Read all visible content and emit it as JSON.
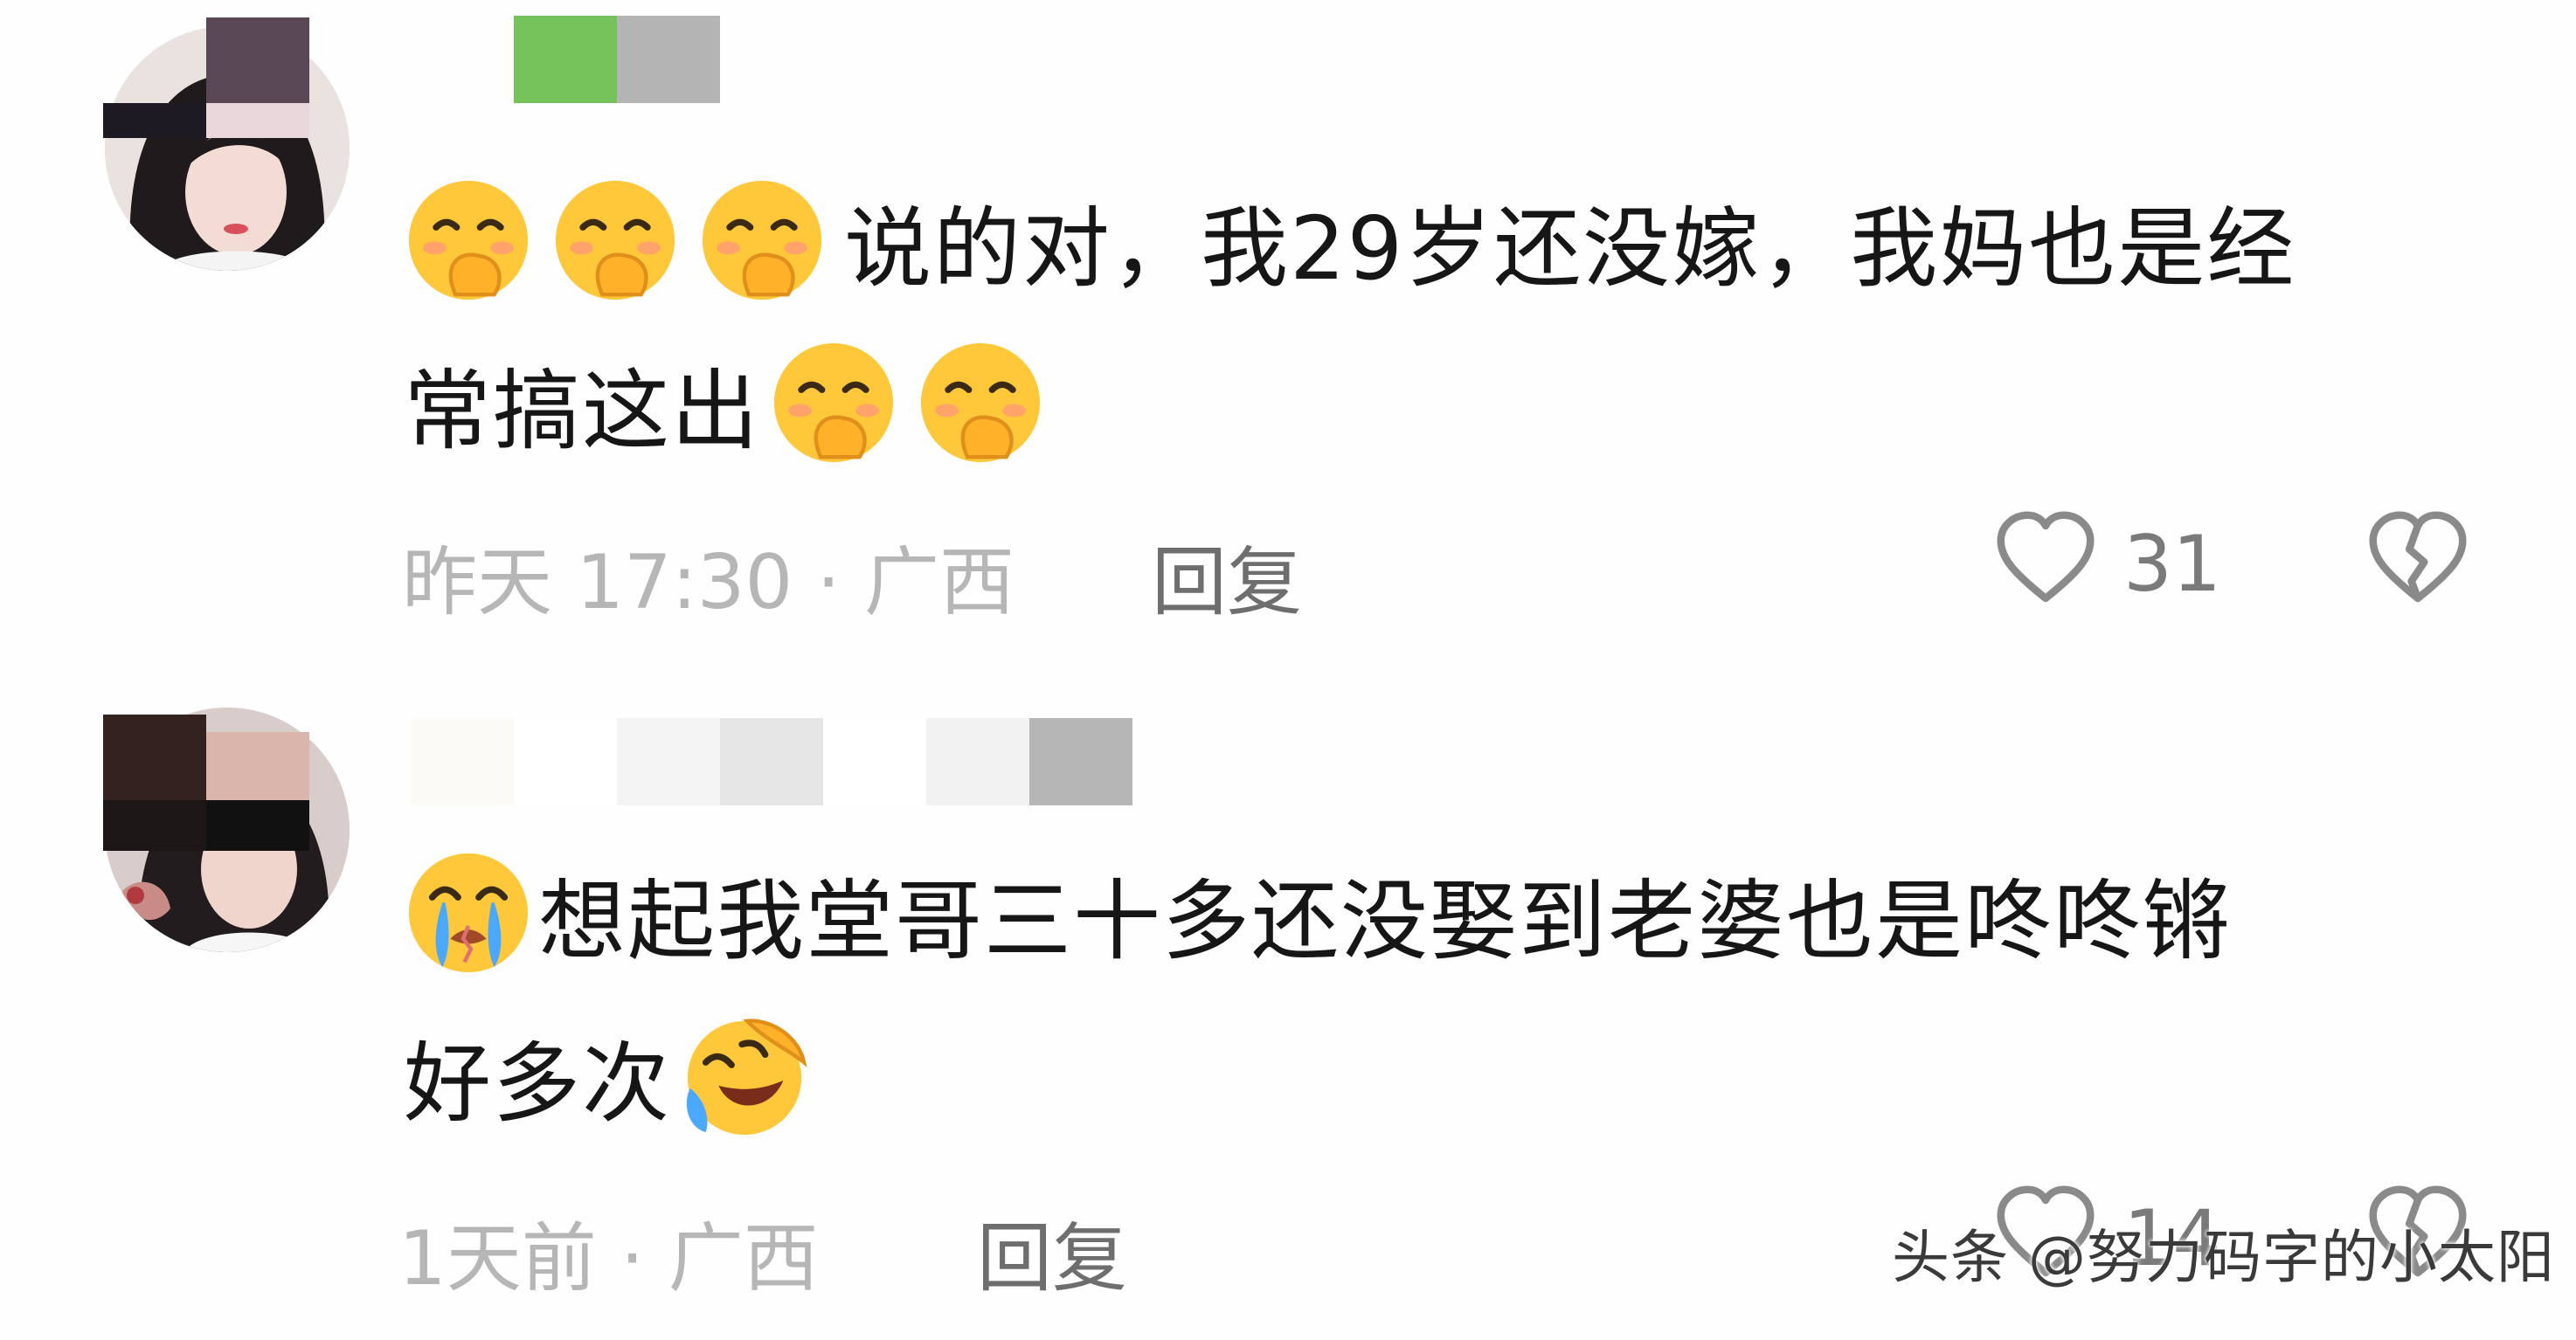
{
  "comments": [
    {
      "text_line1": "说的对，我29岁还没嫁，我妈也是经",
      "text_line2": "常搞这出",
      "meta": "昨天 17:30 · 广西",
      "reply_label": "回复",
      "like_count": "31",
      "icons": [
        "smirk-cover-mouth-emoji",
        "heart-outline-icon",
        "broken-heart-icon"
      ]
    },
    {
      "text_line1": "想起我堂哥三十多还没娶到老婆也是咚咚锵",
      "text_line2": "好多次",
      "meta": "1天前 · 广西",
      "reply_label": "回复",
      "like_count": "14",
      "icons": [
        "crying-emoji",
        "laugh-cry-emoji",
        "heart-outline-icon",
        "broken-heart-icon"
      ]
    }
  ],
  "watermark": "头条 @努力码字的小太阳",
  "colors": {
    "text": "#161616",
    "meta": "#b6b6b6",
    "reply": "#6e6e6e",
    "emoji_yellow": "#ffc83a"
  }
}
